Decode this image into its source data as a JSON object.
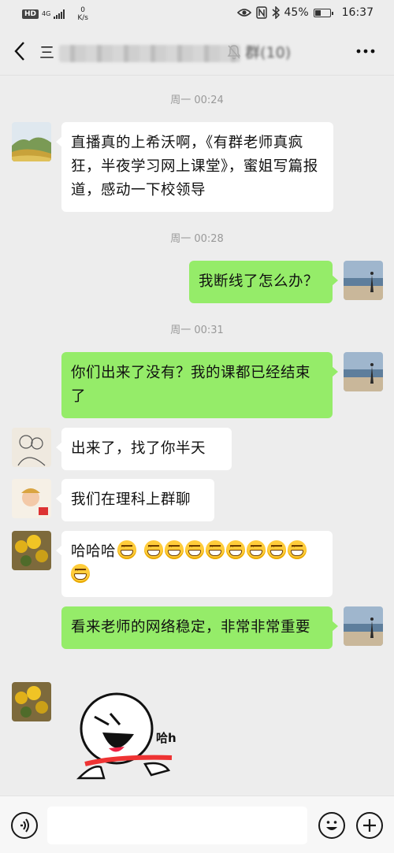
{
  "status_bar": {
    "hd": "HD",
    "network": "4G",
    "speed_value": "0",
    "speed_unit": "K/s",
    "battery_text": "45%",
    "battery_level": 0.45,
    "time": "16:37"
  },
  "header": {
    "title_prefix": "三",
    "title_suffix": "群(10)"
  },
  "messages": [
    {
      "type": "time",
      "text": "周一 00:24"
    },
    {
      "type": "text",
      "side": "left",
      "text": "直播真的上希沃啊，《有群老师真疯狂，半夜学习网上课堂》，蜜姐写篇报道，感动一下校领导"
    },
    {
      "type": "time",
      "text": "周一 00:28"
    },
    {
      "type": "text",
      "side": "right",
      "text": "我断线了怎么办？"
    },
    {
      "type": "time",
      "text": "周一 00:31"
    },
    {
      "type": "text",
      "side": "right",
      "text": "你们出来了没有？我的课都已经结束了"
    },
    {
      "type": "text",
      "side": "left",
      "text": "出来了，找了你半天"
    },
    {
      "type": "text",
      "side": "left",
      "text": "我们在理科上群聊"
    },
    {
      "type": "text",
      "side": "left",
      "text": "哈哈哈",
      "emoji_count": 10
    },
    {
      "type": "text",
      "side": "right",
      "text": "看来老师的网络稳定，非常非常重要"
    },
    {
      "type": "sticker",
      "side": "left",
      "caption": "哈h"
    }
  ],
  "colors": {
    "background": "#ededed",
    "bubble_self": "#95ec69",
    "bubble_other": "#ffffff",
    "timestamp": "#999999"
  },
  "icons": {
    "back": "chevron-left-icon",
    "mute": "bell-off-icon",
    "more": "more-dots-icon",
    "voice": "voice-icon",
    "emoji": "emoji-icon",
    "plus": "plus-icon"
  }
}
